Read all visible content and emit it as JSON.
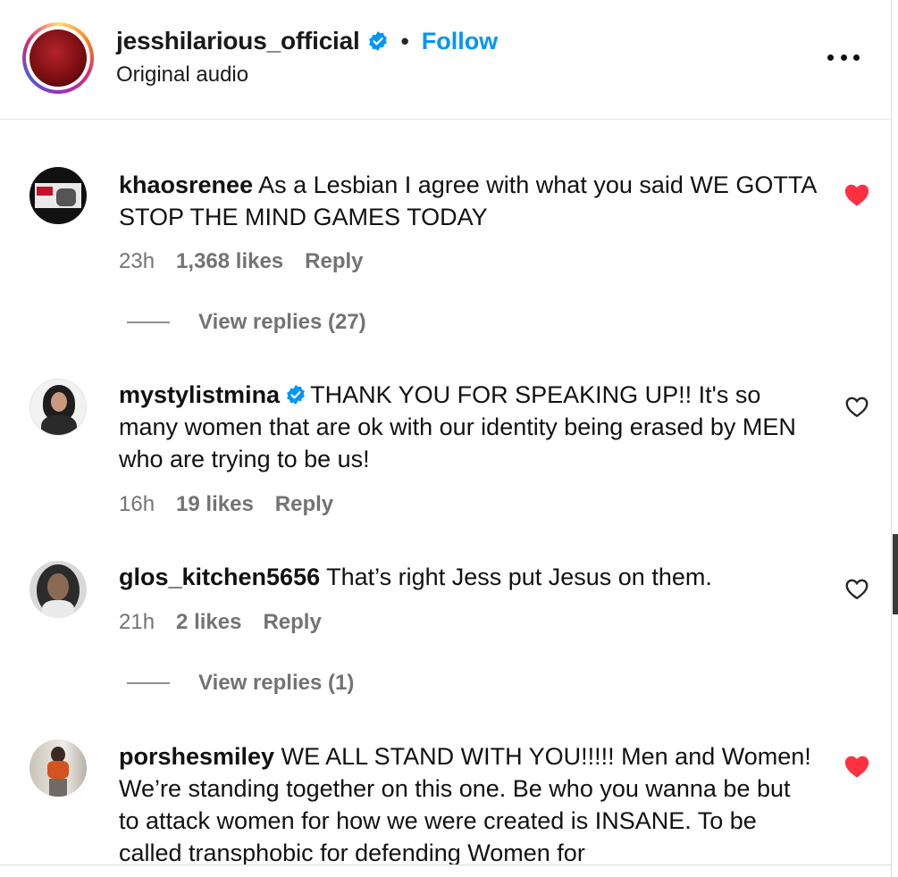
{
  "header": {
    "username": "jesshilarious_official",
    "follow_label": "Follow",
    "separator": "•",
    "subtitle": "Original audio"
  },
  "comments": [
    {
      "username": "khaosrenee",
      "verified": false,
      "text": "As a Lesbian I agree with what you said WE GOTTA STOP THE MIND GAMES TODAY",
      "time": "23h",
      "likes": "1,368 likes",
      "reply_label": "Reply",
      "liked": true,
      "view_replies": "View replies (27)"
    },
    {
      "username": "mystylistmina",
      "verified": true,
      "text": "THANK YOU FOR SPEAKING UP!! It's so many women that are ok with our identity being erased by MEN who are trying to be us!",
      "time": "16h",
      "likes": "19 likes",
      "reply_label": "Reply",
      "liked": false
    },
    {
      "username": "glos_kitchen5656",
      "verified": false,
      "text": "That’s right Jess put Jesus on them.",
      "time": "21h",
      "likes": "2 likes",
      "reply_label": "Reply",
      "liked": false,
      "view_replies": "View replies (1)"
    },
    {
      "username": "porshesmiley",
      "verified": false,
      "text": "WE ALL STAND WITH YOU!!!!! Men and Women! We’re standing together on this one. Be who you wanna be but to attack women for how we were created is INSANE. To be called transphobic for defending Women for",
      "liked": true
    }
  ],
  "colors": {
    "link": "#0095f6",
    "liked_heart": "#ff3040",
    "muted": "#737373"
  }
}
